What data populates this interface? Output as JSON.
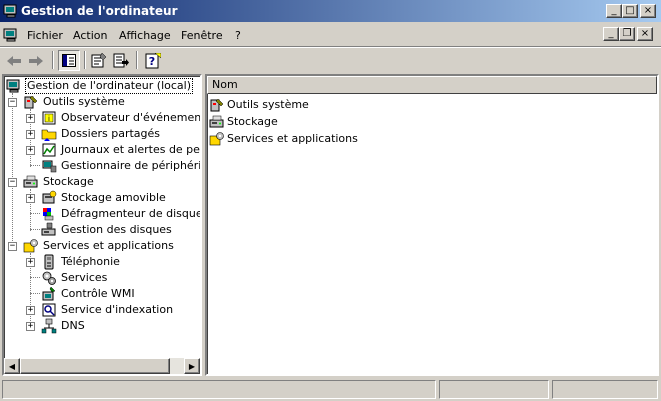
{
  "window": {
    "title": "Gestion de l'ordinateur",
    "controls": {
      "minimize": "_",
      "maximize": "□",
      "close": "×"
    }
  },
  "menu": {
    "items": [
      "Fichier",
      "Action",
      "Affichage",
      "Fenêtre",
      "?"
    ],
    "mdi_controls": {
      "minimize": "_",
      "restore": "❐",
      "close": "×"
    }
  },
  "toolbar": {
    "buttons": [
      {
        "icon": "back-arrow-icon"
      },
      {
        "icon": "forward-arrow-icon"
      },
      {
        "icon": "show-hide-tree-icon",
        "pressed": true
      },
      {
        "icon": "properties-icon"
      },
      {
        "icon": "export-list-icon"
      },
      {
        "icon": "help-icon"
      }
    ]
  },
  "tree": {
    "root": "Gestion de l'ordinateur (local)",
    "groups": [
      {
        "label": "Outils système",
        "expander": "−",
        "children": [
          {
            "label": "Observateur d'événements",
            "expander": "+"
          },
          {
            "label": "Dossiers partagés",
            "expander": "+"
          },
          {
            "label": "Journaux et alertes de perfo",
            "expander": "+"
          },
          {
            "label": "Gestionnaire de périphérique",
            "expander": ""
          }
        ]
      },
      {
        "label": "Stockage",
        "expander": "−",
        "children": [
          {
            "label": "Stockage amovible",
            "expander": "+"
          },
          {
            "label": "Défragmenteur de disque",
            "expander": ""
          },
          {
            "label": "Gestion des disques",
            "expander": ""
          }
        ]
      },
      {
        "label": "Services et applications",
        "expander": "−",
        "children": [
          {
            "label": "Téléphonie",
            "expander": "+"
          },
          {
            "label": "Services",
            "expander": ""
          },
          {
            "label": "Contrôle WMI",
            "expander": ""
          },
          {
            "label": "Service d'indexation",
            "expander": "+"
          },
          {
            "label": "DNS",
            "expander": "+"
          }
        ]
      }
    ]
  },
  "list": {
    "column": "Nom",
    "items": [
      "Outils système",
      "Stockage",
      "Services et applications"
    ]
  },
  "scrollbar": {
    "left_arrow": "◀",
    "right_arrow": "▶"
  }
}
